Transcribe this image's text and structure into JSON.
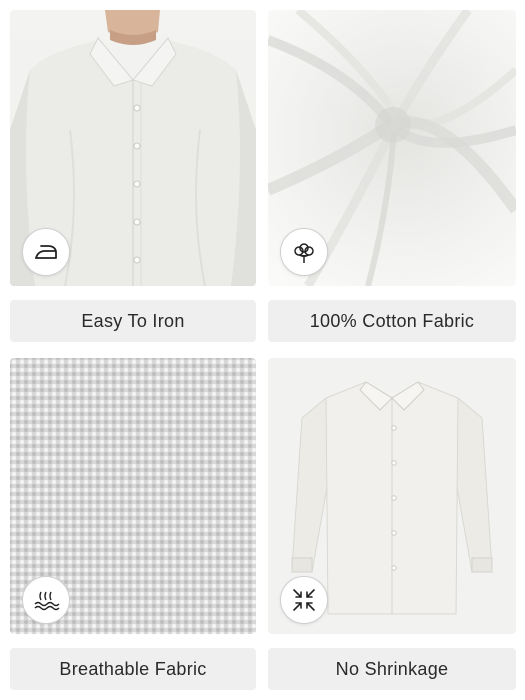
{
  "features": [
    {
      "label": "Easy To Iron",
      "icon": "iron-icon"
    },
    {
      "label": "100% Cotton Fabric",
      "icon": "cotton-flower-icon"
    },
    {
      "label": "Breathable Fabric",
      "icon": "breathable-fabric-icon"
    },
    {
      "label": "No Shrinkage",
      "icon": "no-shrink-arrows-icon"
    }
  ]
}
